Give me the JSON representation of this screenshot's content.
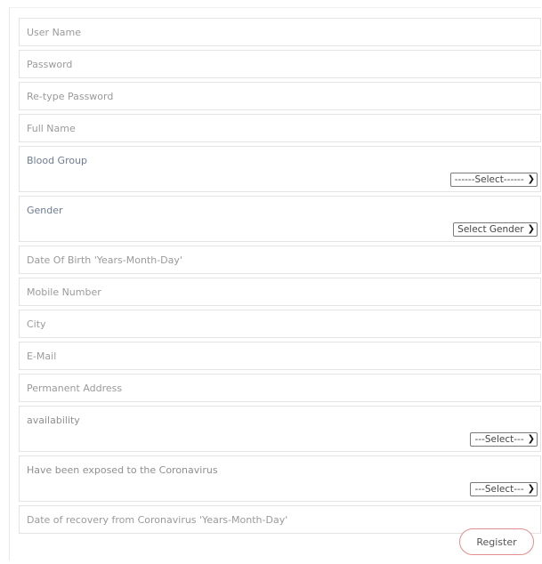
{
  "form": {
    "fields": {
      "username": "User Name",
      "password": "Password",
      "retype_password": "Re-type Password",
      "full_name": "Full Name",
      "dob": "Date Of Birth 'Years-Month-Day'",
      "mobile": "Mobile Number",
      "city": "City",
      "email": "E-Mail",
      "address": "Permanent Address",
      "recovery_date": "Date of recovery from Coronavirus 'Years-Month-Day'"
    },
    "blood_group": {
      "label": "Blood Group",
      "selected": "------Select------"
    },
    "gender": {
      "label": "Gender",
      "selected": "Select Gender"
    },
    "availability": {
      "label": "availability",
      "selected": "---Select---"
    },
    "exposed": {
      "label": "Have been exposed to the Coronavirus",
      "selected": "---Select---"
    },
    "register_label": "Register"
  },
  "icons": {
    "dropdown": "chevron-down-icon"
  },
  "colors": {
    "label_accent": "#6d7c92",
    "button_border": "#e38e8e"
  }
}
